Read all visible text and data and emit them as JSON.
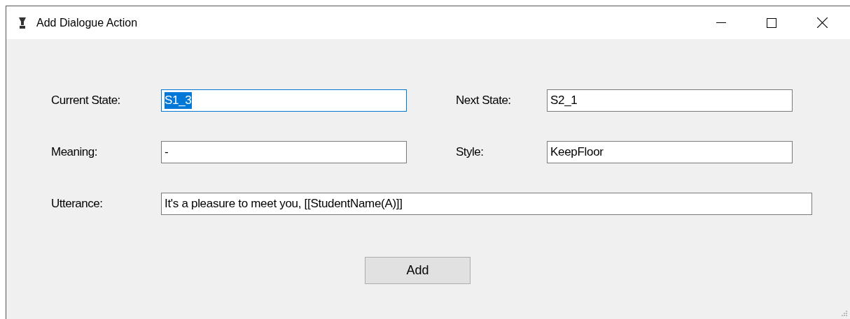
{
  "window": {
    "title": "Add Dialogue Action"
  },
  "rows": [
    {
      "fields": [
        {
          "label": "Current State:",
          "value": "S1_3",
          "focused": true
        },
        {
          "label": "Next State:",
          "value": "S2_1",
          "focused": false
        }
      ]
    },
    {
      "fields": [
        {
          "label": "Meaning:",
          "value": "-",
          "focused": false
        },
        {
          "label": "Style:",
          "value": "KeepFloor",
          "focused": false
        }
      ]
    },
    {
      "fields": [
        {
          "label": "Utterance:",
          "value": "It's a pleasure to meet you, [[StudentName(A)]]",
          "focused": false
        }
      ]
    }
  ],
  "buttons": [
    "Add"
  ]
}
